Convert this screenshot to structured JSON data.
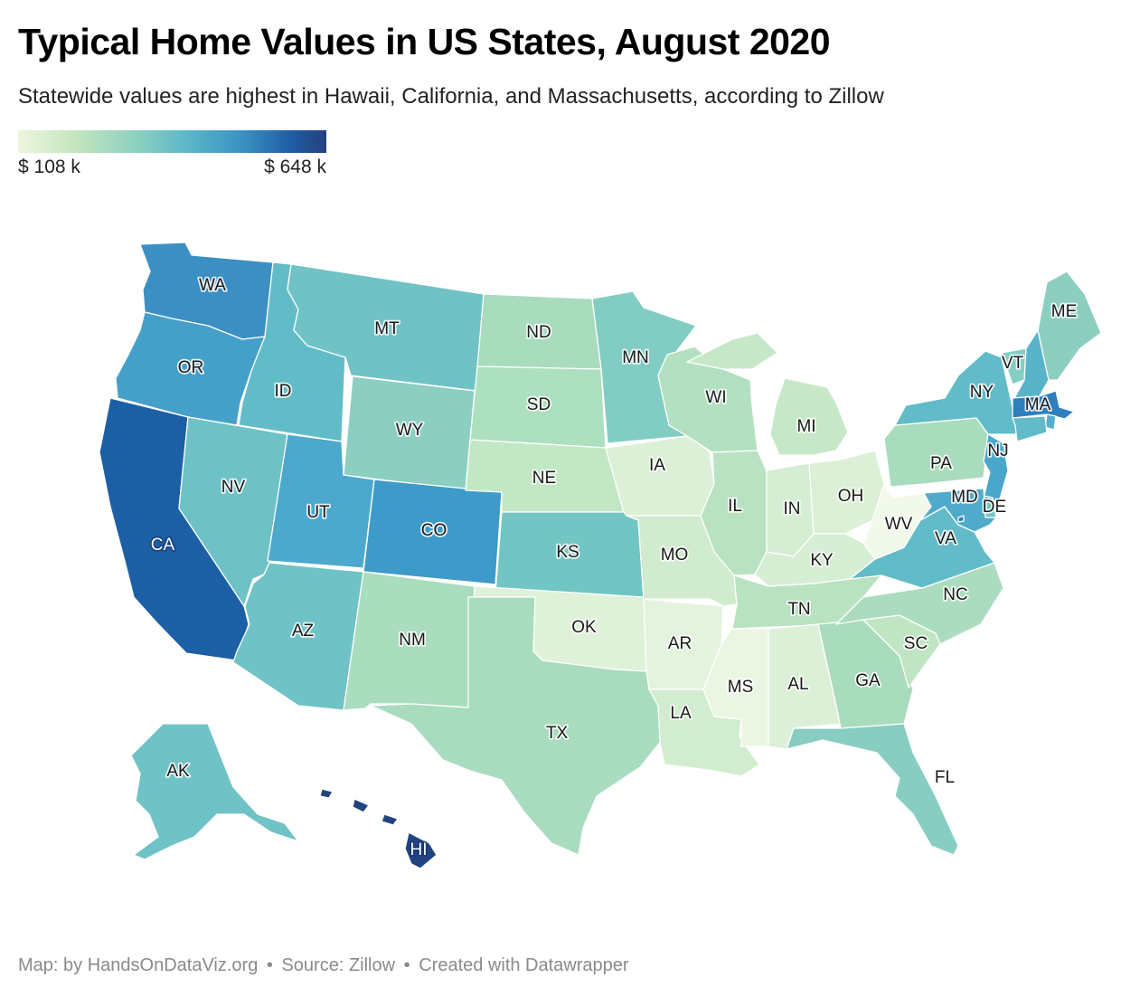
{
  "title": "Typical Home Values in US States, August 2020",
  "subtitle": "Statewide values are highest in Hawaii, California, and Massachusetts, according to Zillow",
  "legend": {
    "min_label": "$ 108 k",
    "max_label": "$ 648 k",
    "min_value": 108,
    "max_value": 648,
    "colors": [
      "#ecf6df",
      "#c6e6bf",
      "#8ed1c0",
      "#5bb7c8",
      "#3c93c4",
      "#1f5fa6",
      "#23417e"
    ]
  },
  "states": [
    {
      "abbr": "WA",
      "fill": "#3b8fc3"
    },
    {
      "abbr": "OR",
      "fill": "#45a0c9"
    },
    {
      "abbr": "CA",
      "fill": "#1c5fa5"
    },
    {
      "abbr": "ID",
      "fill": "#62bcc7"
    },
    {
      "abbr": "NV",
      "fill": "#6ec2c5"
    },
    {
      "abbr": "MT",
      "fill": "#70c2c5"
    },
    {
      "abbr": "WY",
      "fill": "#8ccfc1"
    },
    {
      "abbr": "UT",
      "fill": "#4ca8cc"
    },
    {
      "abbr": "AZ",
      "fill": "#6fc2c5"
    },
    {
      "abbr": "CO",
      "fill": "#3e9ac8"
    },
    {
      "abbr": "NM",
      "fill": "#aadcbe"
    },
    {
      "abbr": "ND",
      "fill": "#a9dbbd"
    },
    {
      "abbr": "SD",
      "fill": "#ade0be"
    },
    {
      "abbr": "NE",
      "fill": "#c2e7c4"
    },
    {
      "abbr": "KS",
      "fill": "#71c5c3"
    },
    {
      "abbr": "OK",
      "fill": "#dff1d8"
    },
    {
      "abbr": "TX",
      "fill": "#a9dcbf"
    },
    {
      "abbr": "MN",
      "fill": "#82cdc3"
    },
    {
      "abbr": "IA",
      "fill": "#dcf0d7"
    },
    {
      "abbr": "MO",
      "fill": "#d0ebce"
    },
    {
      "abbr": "AR",
      "fill": "#e4f3dd"
    },
    {
      "abbr": "LA",
      "fill": "#d2ecd0"
    },
    {
      "abbr": "WI",
      "fill": "#b3e0c0"
    },
    {
      "abbr": "IL",
      "fill": "#b9e2c2"
    },
    {
      "abbr": "MI",
      "fill": "#c6e8c8"
    },
    {
      "abbr": "IN",
      "fill": "#d5edd2"
    },
    {
      "abbr": "OH",
      "fill": "#dcf0d7"
    },
    {
      "abbr": "KY",
      "fill": "#d6eed3"
    },
    {
      "abbr": "TN",
      "fill": "#b9e2c0"
    },
    {
      "abbr": "MS",
      "fill": "#eaf6e2"
    },
    {
      "abbr": "AL",
      "fill": "#dcf0d7"
    },
    {
      "abbr": "GA",
      "fill": "#a9dbbd"
    },
    {
      "abbr": "FL",
      "fill": "#87cdc2"
    },
    {
      "abbr": "SC",
      "fill": "#bfe5c2"
    },
    {
      "abbr": "NC",
      "fill": "#abdcbf"
    },
    {
      "abbr": "VA",
      "fill": "#62bbc8"
    },
    {
      "abbr": "WV",
      "fill": "#f1f9ea"
    },
    {
      "abbr": "PA",
      "fill": "#a9dbbd"
    },
    {
      "abbr": "NY",
      "fill": "#62bbc8"
    },
    {
      "abbr": "VT",
      "fill": "#83cdc2"
    },
    {
      "abbr": "NH",
      "fill": "#5ab4c9"
    },
    {
      "abbr": "ME",
      "fill": "#8ccfc1"
    },
    {
      "abbr": "MA",
      "fill": "#2f7fbd"
    },
    {
      "abbr": "RI",
      "fill": "#52aecb"
    },
    {
      "abbr": "CT",
      "fill": "#62bbc8"
    },
    {
      "abbr": "NJ",
      "fill": "#4aa7cc"
    },
    {
      "abbr": "DE",
      "fill": "#74c5c3"
    },
    {
      "abbr": "MD",
      "fill": "#50abcb"
    },
    {
      "abbr": "DC",
      "fill": "#2f7fbd"
    },
    {
      "abbr": "AK",
      "fill": "#6fc2c5"
    },
    {
      "abbr": "HI",
      "fill": "#21447f"
    }
  ],
  "footer": {
    "credit": "Map: by HandsOnDataViz.org",
    "separator1": "•",
    "source": "Source: Zillow",
    "separator2": "•",
    "tool": "Created with Datawrapper"
  }
}
